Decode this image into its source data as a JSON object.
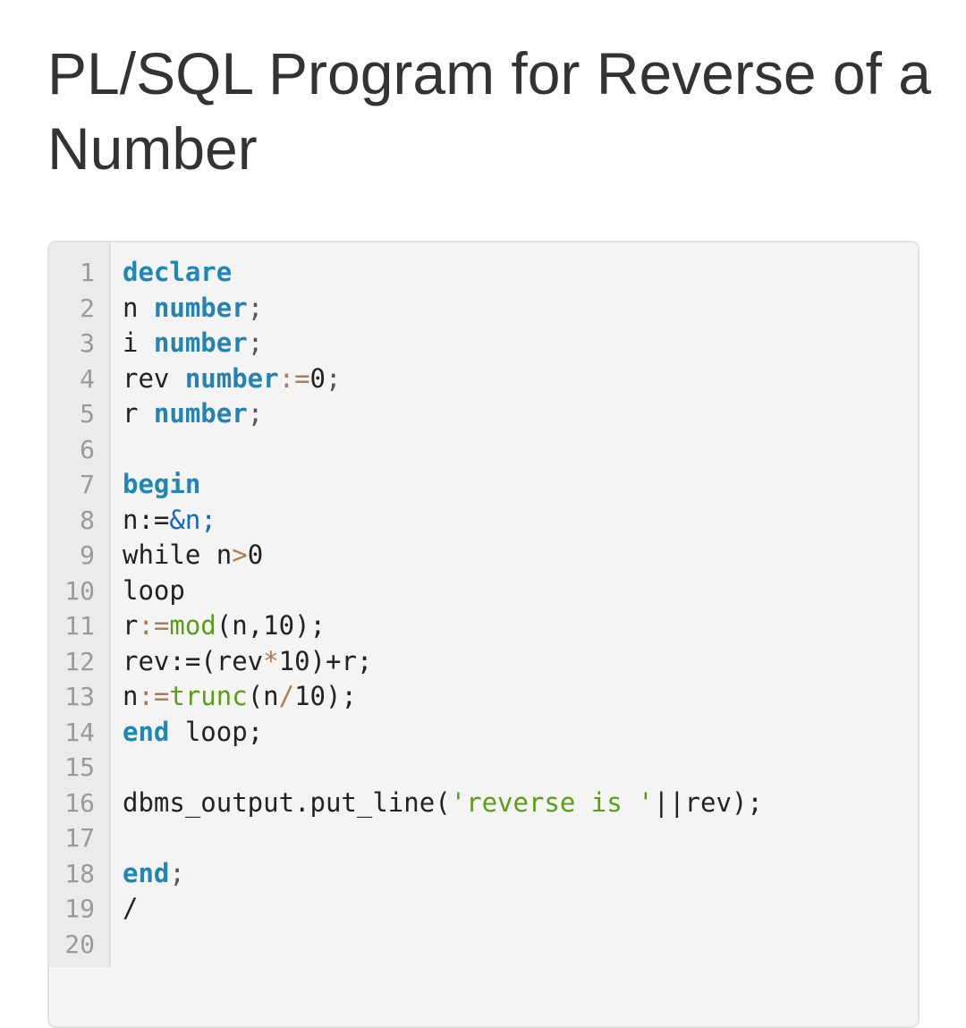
{
  "page": {
    "title": "PL/SQL Program for Reverse of a Number"
  },
  "code_block": {
    "lines": [
      {
        "number": "1",
        "tokens": [
          {
            "text": "declare",
            "kind": "kw"
          }
        ]
      },
      {
        "number": "2",
        "tokens": [
          {
            "text": "n ",
            "kind": "plain"
          },
          {
            "text": "number",
            "kind": "type"
          },
          {
            "text": ";",
            "kind": "punct"
          }
        ]
      },
      {
        "number": "3",
        "tokens": [
          {
            "text": "i ",
            "kind": "plain"
          },
          {
            "text": "number",
            "kind": "type"
          },
          {
            "text": ";",
            "kind": "punct"
          }
        ]
      },
      {
        "number": "4",
        "tokens": [
          {
            "text": "rev ",
            "kind": "plain"
          },
          {
            "text": "number",
            "kind": "type"
          },
          {
            "text": ":=",
            "kind": "op"
          },
          {
            "text": "0",
            "kind": "num"
          },
          {
            "text": ";",
            "kind": "punct"
          }
        ]
      },
      {
        "number": "5",
        "tokens": [
          {
            "text": "r ",
            "kind": "plain"
          },
          {
            "text": "number",
            "kind": "type"
          },
          {
            "text": ";",
            "kind": "punct"
          }
        ]
      },
      {
        "number": "6",
        "tokens": []
      },
      {
        "number": "7",
        "tokens": [
          {
            "text": "begin",
            "kind": "kw"
          }
        ]
      },
      {
        "number": "8",
        "tokens": [
          {
            "text": "n:=",
            "kind": "plain"
          },
          {
            "text": "&n",
            "kind": "var"
          },
          {
            "text": ";",
            "kind": "var"
          }
        ]
      },
      {
        "number": "9",
        "tokens": [
          {
            "text": "while n",
            "kind": "plain"
          },
          {
            "text": ">",
            "kind": "op"
          },
          {
            "text": "0",
            "kind": "num"
          }
        ]
      },
      {
        "number": "10",
        "tokens": [
          {
            "text": "loop",
            "kind": "plain"
          }
        ]
      },
      {
        "number": "11",
        "tokens": [
          {
            "text": "r",
            "kind": "plain"
          },
          {
            "text": ":=",
            "kind": "op"
          },
          {
            "text": "mod",
            "kind": "fn"
          },
          {
            "text": "(n,10);",
            "kind": "plain"
          }
        ]
      },
      {
        "number": "12",
        "tokens": [
          {
            "text": "rev:=(rev",
            "kind": "plain"
          },
          {
            "text": "*",
            "kind": "op"
          },
          {
            "text": "10)+r;",
            "kind": "plain"
          }
        ]
      },
      {
        "number": "13",
        "tokens": [
          {
            "text": "n",
            "kind": "plain"
          },
          {
            "text": ":=",
            "kind": "op"
          },
          {
            "text": "trunc",
            "kind": "fn"
          },
          {
            "text": "(n",
            "kind": "plain"
          },
          {
            "text": "/",
            "kind": "op"
          },
          {
            "text": "10);",
            "kind": "plain"
          }
        ]
      },
      {
        "number": "14",
        "tokens": [
          {
            "text": "end",
            "kind": "kw"
          },
          {
            "text": " loop;",
            "kind": "plain"
          }
        ]
      },
      {
        "number": "15",
        "tokens": []
      },
      {
        "number": "16",
        "tokens": [
          {
            "text": "dbms_output.put_line(",
            "kind": "plain"
          },
          {
            "text": "'reverse is '",
            "kind": "str"
          },
          {
            "text": "||rev);",
            "kind": "plain"
          }
        ]
      },
      {
        "number": "17",
        "tokens": []
      },
      {
        "number": "18",
        "tokens": [
          {
            "text": "end",
            "kind": "kw"
          },
          {
            "text": ";",
            "kind": "punct"
          }
        ]
      },
      {
        "number": "19",
        "tokens": [
          {
            "text": "/",
            "kind": "plain"
          }
        ]
      },
      {
        "number": "20",
        "tokens": []
      }
    ]
  },
  "colors": {
    "keyword": "#1f86b5",
    "operator": "#a67f59",
    "function_string": "#5a9e17",
    "variable": "#1866c4",
    "line_number": "#9a9a9a",
    "code_background": "#f4f4f4"
  }
}
